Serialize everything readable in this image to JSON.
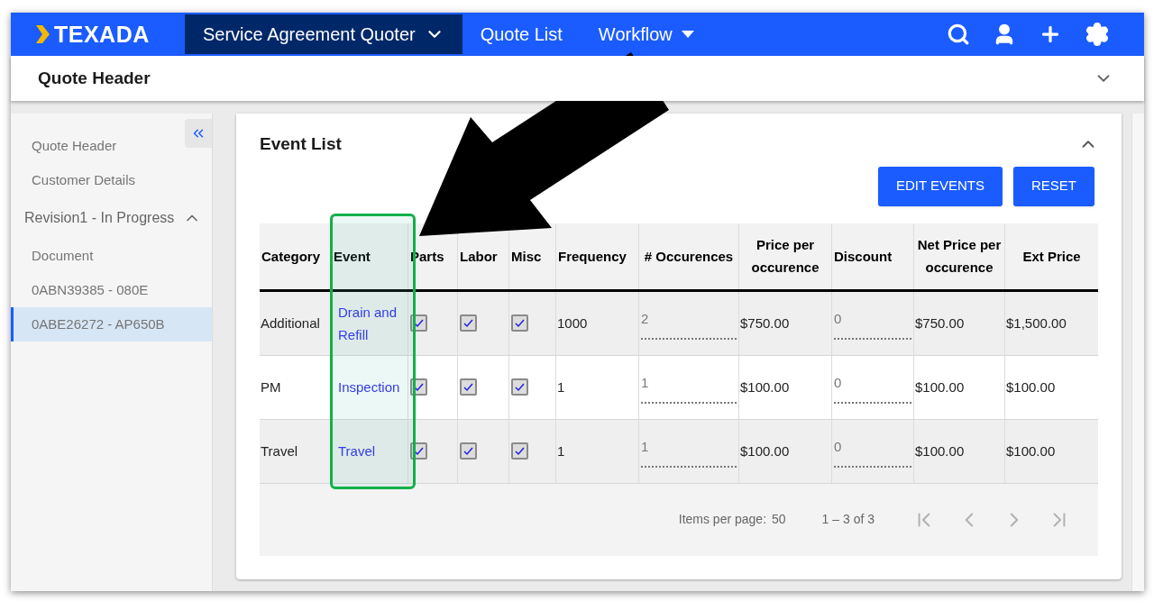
{
  "topbar": {
    "logo": "TEXADA",
    "menus": [
      {
        "label": "Service Agreement Quoter",
        "selected": true,
        "kind": "chevron"
      },
      {
        "label": "Quote List",
        "selected": false,
        "kind": "plain"
      },
      {
        "label": "Workflow",
        "selected": false,
        "kind": "caret"
      }
    ]
  },
  "header": {
    "title": "Quote Header",
    "expanded": false
  },
  "sidebar": {
    "items": [
      {
        "label": "Quote Header",
        "selected": false,
        "kind": "link"
      },
      {
        "label": "Customer Details",
        "selected": false,
        "kind": "link"
      },
      {
        "label": "Revision1 - In Progress",
        "selected": false,
        "kind": "group",
        "expanded": true
      },
      {
        "label": "Document",
        "selected": false,
        "kind": "link"
      },
      {
        "label": "0ABN39385 - 080E",
        "selected": false,
        "kind": "link"
      },
      {
        "label": "0ABE26272 - AP650B",
        "selected": true,
        "kind": "link"
      }
    ]
  },
  "card": {
    "title": "Event List",
    "expanded": true,
    "buttons": [
      "EDIT EVENTS",
      "RESET"
    ]
  },
  "table": {
    "columns": [
      "Category",
      "Event",
      "Parts",
      "Labor",
      "Misc",
      "Frequency",
      "# Occurences",
      "Price per occurence",
      "Discount",
      "Net Price per occurence",
      "Ext Price"
    ],
    "rows": [
      {
        "category": "Additional",
        "event": "Drain and Refill",
        "parts": true,
        "labor": true,
        "misc": true,
        "frequency": "1000",
        "occurences": "2",
        "price": "$750.00",
        "discount": "0",
        "net_price": "$750.00",
        "ext_price": "$1,500.00"
      },
      {
        "category": "PM",
        "event": "Inspection",
        "parts": true,
        "labor": true,
        "misc": true,
        "frequency": "1",
        "occurences": "1",
        "price": "$100.00",
        "discount": "0",
        "net_price": "$100.00",
        "ext_price": "$100.00"
      },
      {
        "category": "Travel",
        "event": "Travel",
        "parts": true,
        "labor": true,
        "misc": true,
        "frequency": "1",
        "occurences": "1",
        "price": "$100.00",
        "discount": "0",
        "net_price": "$100.00",
        "ext_price": "$100.00"
      }
    ]
  },
  "paginator": {
    "items_label": "Items per page:",
    "page_size": "50",
    "range": "1 – 3 of 3",
    "buttons": [
      {
        "kind": "first",
        "disabled": true
      },
      {
        "kind": "prev",
        "disabled": true
      },
      {
        "kind": "next",
        "disabled": true
      },
      {
        "kind": "last",
        "disabled": true
      }
    ]
  }
}
